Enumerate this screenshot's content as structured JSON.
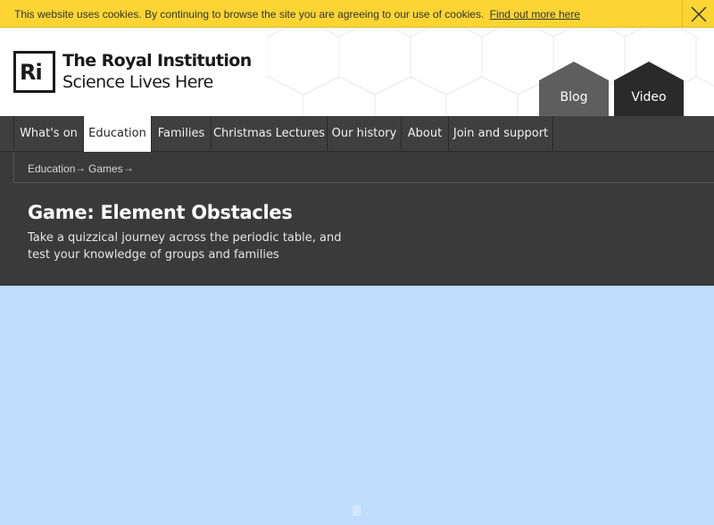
{
  "cookie": {
    "message": "This website uses cookies. By continuing to browse the site you are agreeing to our use of cookies.",
    "link_label": "Find out more here",
    "close_icon": "close-icon"
  },
  "header": {
    "logo_mark": "Ri",
    "logo_line1": "The Royal Institution",
    "logo_line2": "Science Lives Here",
    "blog_label": "Blog",
    "video_label": "Video"
  },
  "nav": {
    "items": [
      {
        "label": "What's on"
      },
      {
        "label": "Education"
      },
      {
        "label": "Families"
      },
      {
        "label": "Christmas Lectures"
      },
      {
        "label": "Our history"
      },
      {
        "label": "About"
      },
      {
        "label": "Join and support"
      }
    ],
    "active": "Education"
  },
  "breadcrumb": {
    "items": [
      {
        "label": "Education"
      },
      {
        "label": "Games"
      }
    ],
    "separator": "→"
  },
  "page": {
    "title": "Game: Element Obstacles",
    "description": "Take a quizzical journey across the periodic table, and test your knowledge of groups and families"
  },
  "colors": {
    "cookie_bar": "#fcd533",
    "nav_bg": "#3f3f3f",
    "subheader_bg": "#3a3a3a",
    "game_bg": "#c0dcfd",
    "blog_hex": "#5e5e5e",
    "video_hex": "#2a2a2a"
  }
}
